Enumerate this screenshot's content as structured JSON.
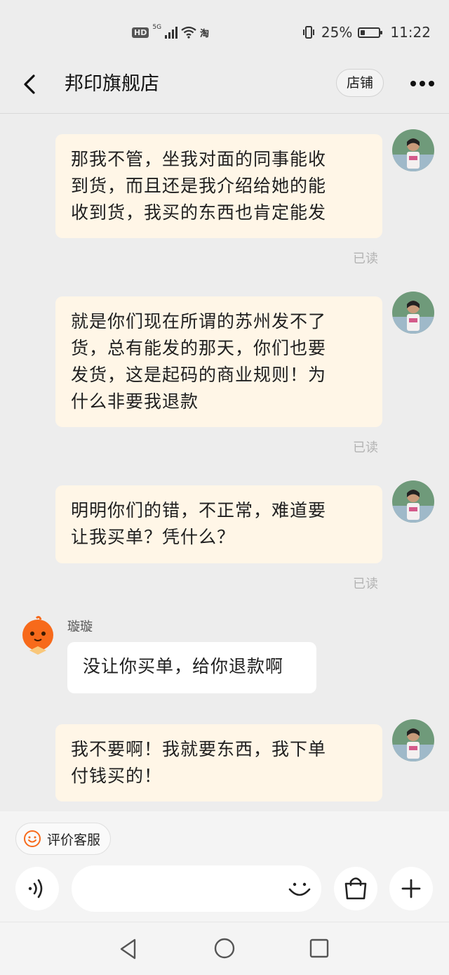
{
  "status_bar": {
    "network_type": "5G",
    "hd": "HD",
    "app_icon_text": "淘",
    "battery_pct_text": "25%",
    "battery_level": 0.25,
    "time": "11:22"
  },
  "header": {
    "title": "邦印旗舰店",
    "shop_button": "店铺",
    "back_icon": "back-arrow-icon",
    "more_icon": "more-dots-icon"
  },
  "messages": [
    {
      "from": "me",
      "text": "那我不管，坐我对面的同事能收\n到货，而且还是我介绍给她的能\n收到货，我买的东西也肯定能发",
      "status": "已读"
    },
    {
      "from": "me",
      "text": "就是你们现在所谓的苏州发不了\n货，总有能发的那天，你们也要\n发货，这是起码的商业规则！为\n什么非要我退款",
      "status": "已读"
    },
    {
      "from": "me",
      "text": "明明你们的错，不正常，难道要\n让我买单？凭什么？",
      "status": "已读"
    },
    {
      "from": "agent",
      "sender": "璇璇",
      "text": "没让你买单，给你退款啊"
    },
    {
      "from": "me",
      "text": "我不要啊！我就要东西，我下单\n付钱买的！"
    }
  ],
  "bottom": {
    "rate_label": "评价客服",
    "input_placeholder": "",
    "voice_icon": "voice-icon",
    "emoji_icon": "emoji-icon",
    "shop_bag_icon": "shopping-bag-icon",
    "plus_icon": "plus-icon"
  },
  "colors": {
    "my_bubble": "#fff6e7",
    "agent_bubble": "#ffffff",
    "background": "#ededed",
    "accent_orange": "#f76a1b"
  }
}
